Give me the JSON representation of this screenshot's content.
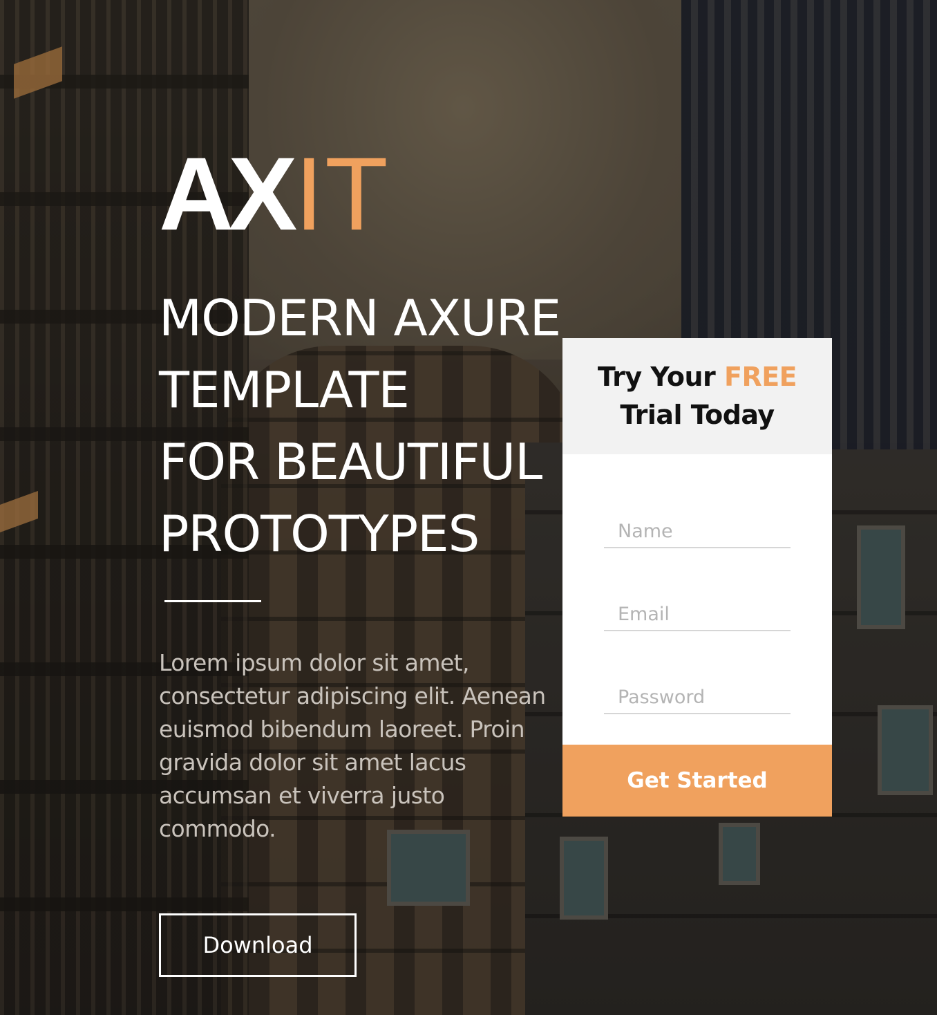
{
  "logo": {
    "primary": "AX",
    "accent": "IT"
  },
  "hero": {
    "headline": [
      "MODERN AXURE",
      "TEMPLATE",
      "FOR BEAUTIFUL",
      "PROTOTYPES"
    ],
    "body": "Lorem ipsum dolor sit amet, consectetur adipiscing elit. Aenean euismod bibendum laoreet. Proin gravida dolor sit amet lacus accumsan et viverra justo commodo.",
    "download_label": "Download"
  },
  "trial_card": {
    "title_prefix": "Try Your",
    "title_highlight": "FREE",
    "title_line2": "Trial Today",
    "fields": {
      "name": {
        "placeholder": "Name",
        "value": ""
      },
      "email": {
        "placeholder": "Email",
        "value": ""
      },
      "password": {
        "placeholder": "Password",
        "value": ""
      }
    },
    "cta_label": "Get Started"
  },
  "colors": {
    "accent": "#f0a15e",
    "card_header_bg": "#f2f2f2",
    "text_light": "#ffffff",
    "body_text": "#c9c3bc"
  }
}
